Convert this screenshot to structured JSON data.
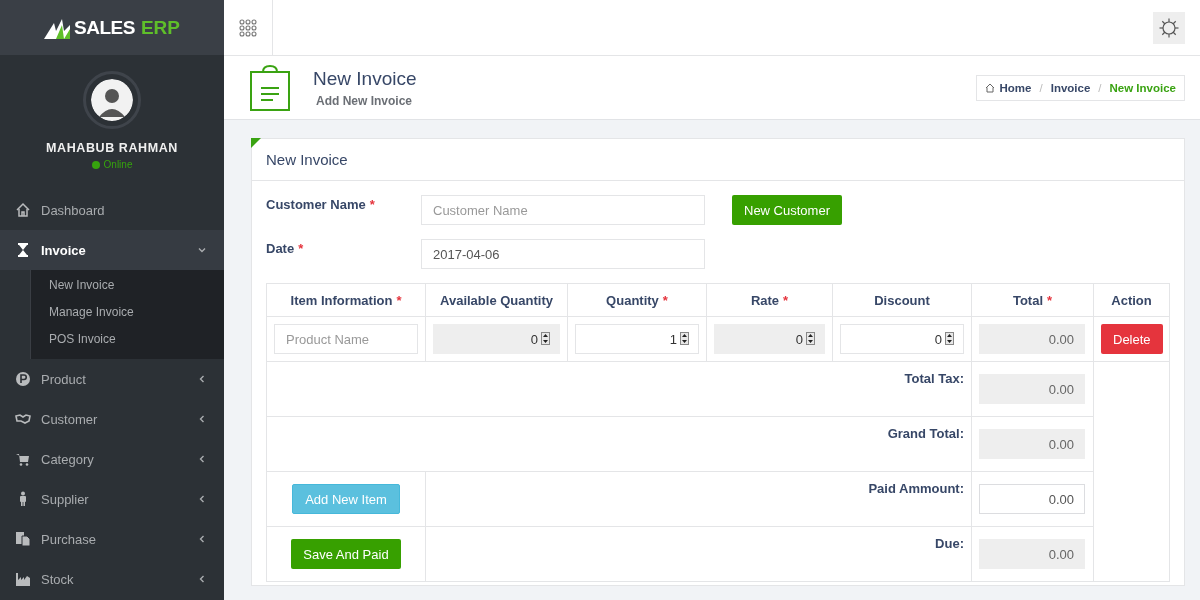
{
  "logo": {
    "text_1": "SALES",
    "text_2": "ERP"
  },
  "profile": {
    "name": "MAHABUB RAHMAN",
    "status": "Online"
  },
  "menu": [
    {
      "label": "Dashboard",
      "selected": false,
      "has_submenu": false
    },
    {
      "label": "Invoice",
      "selected": true,
      "expanded": true,
      "has_submenu": true,
      "children": [
        {
          "label": "New Invoice",
          "selected": false
        },
        {
          "label": "Manage Invoice",
          "selected": false
        },
        {
          "label": "POS Invoice",
          "selected": false
        }
      ]
    },
    {
      "label": "Product",
      "selected": false,
      "expanded": false,
      "has_submenu": true
    },
    {
      "label": "Customer",
      "selected": false,
      "expanded": false,
      "has_submenu": true
    },
    {
      "label": "Category",
      "selected": false,
      "expanded": false,
      "has_submenu": true
    },
    {
      "label": "Supplier",
      "selected": false,
      "expanded": false,
      "has_submenu": true
    },
    {
      "label": "Purchase",
      "selected": false,
      "expanded": false,
      "has_submenu": true
    },
    {
      "label": "Stock",
      "selected": false,
      "expanded": false,
      "has_submenu": true
    }
  ],
  "page_header": {
    "title": "New Invoice",
    "subtitle": "Add New Invoice"
  },
  "breadcrumbs": [
    {
      "label": "Home",
      "selected": false
    },
    {
      "separator": "/",
      "label": "Invoice",
      "selected": false
    },
    {
      "separator": "/",
      "label": "New Invoice",
      "selected": true
    }
  ],
  "panel": {
    "title": "New Invoice"
  },
  "form": {
    "customer_name": {
      "label": "Customer Name",
      "required_mark": "*",
      "placeholder": "Customer Name"
    },
    "date": {
      "label": "Date",
      "required_mark": "*",
      "value": "2017-04-06"
    },
    "new_customer_button": "New Customer"
  },
  "table": {
    "columns": [
      {
        "label": "Item Information",
        "required_mark": "*"
      },
      {
        "label": "Available Quantity"
      },
      {
        "label": "Quantity",
        "required_mark": "*"
      },
      {
        "label": "Rate",
        "required_mark": "*"
      },
      {
        "label": "Discount"
      },
      {
        "label": "Total",
        "required_mark": "*"
      },
      {
        "label": "Action"
      }
    ],
    "row": {
      "product": {
        "placeholder": "Product Name"
      },
      "available_quantity": {
        "value": "0",
        "disabled": true
      },
      "quantity": {
        "value": "1",
        "disabled": false
      },
      "rate": {
        "value": "0",
        "disabled": true
      },
      "discount": {
        "value": "0",
        "disabled": false
      },
      "total": {
        "value": "0.00",
        "disabled": true
      },
      "delete_button": "Delete"
    },
    "summary": [
      {
        "label": "Total Tax:",
        "value": "0.00",
        "disabled": true
      },
      {
        "label": "Grand Total:",
        "value": "0.00",
        "disabled": true
      },
      {
        "label": "Paid Ammount:",
        "value": "0.00",
        "disabled": false,
        "button": {
          "label": "Add New Item",
          "kind": "info"
        }
      },
      {
        "label": "Due:",
        "value": "0.00",
        "disabled": true,
        "button": {
          "label": "Save And Paid",
          "kind": "success"
        }
      }
    ]
  }
}
